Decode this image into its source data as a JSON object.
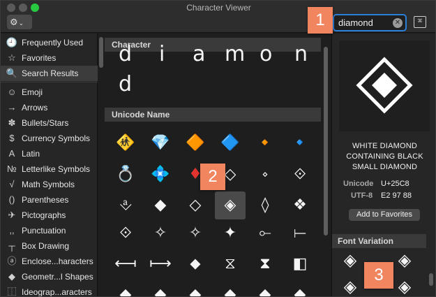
{
  "window": {
    "title": "Character Viewer"
  },
  "toolbar": {
    "gear_icon": "gear-icon",
    "search_value": "diamond",
    "grid_icon": "keyboard-grid-icon"
  },
  "callouts": [
    "1",
    "2",
    "3"
  ],
  "sidebar": {
    "items": [
      {
        "label": "Frequently Used",
        "icon": "🕘"
      },
      {
        "label": "Favorites",
        "icon": "☆"
      },
      {
        "label": "Search Results",
        "icon": "🔍",
        "selected": true
      },
      {
        "label": "Emoji",
        "icon": "☺"
      },
      {
        "label": "Arrows",
        "icon": "→"
      },
      {
        "label": "Bullets/Stars",
        "icon": "✽"
      },
      {
        "label": "Currency Symbols",
        "icon": "$"
      },
      {
        "label": "Latin",
        "icon": "A"
      },
      {
        "label": "Letterlike Symbols",
        "icon": "№"
      },
      {
        "label": "Math Symbols",
        "icon": "√"
      },
      {
        "label": "Parentheses",
        "icon": "()"
      },
      {
        "label": "Pictographs",
        "icon": "✈"
      },
      {
        "label": "Punctuation",
        "icon": ",,"
      },
      {
        "label": "Box Drawing",
        "icon": "┬"
      },
      {
        "label": "Enclose...haracters",
        "icon": "ⓐ"
      },
      {
        "label": "Geometr...l Shapes",
        "icon": "◆"
      },
      {
        "label": "Ideograp...aracters",
        "icon": "⿰"
      }
    ]
  },
  "center": {
    "character_header": "Character",
    "big_chars_row1": [
      "d",
      "i",
      "a",
      "m",
      "o",
      "n"
    ],
    "big_chars_row2": [
      "d"
    ],
    "unicode_header": "Unicode Name",
    "glyph_rows": [
      [
        "🚸",
        "💎",
        "🔶",
        "🔷",
        "🔸",
        "🔹"
      ],
      [
        "💍",
        "💠",
        "♦",
        "◇",
        "⋄",
        "⟐"
      ],
      [
        "⎀",
        "◆",
        "◇",
        "◈",
        "◊",
        "❖"
      ],
      [
        "⟐",
        "✧",
        "✧",
        "✦",
        "⟜",
        "⟝"
      ],
      [
        "⟻",
        "⟼",
        "⬥",
        "⧖",
        "⧗",
        "◧"
      ],
      [
        "◆",
        "◆",
        "◆",
        "◆",
        "◆",
        "◆"
      ]
    ]
  },
  "detail": {
    "name_lines": [
      "WHITE DIAMOND",
      "CONTAINING BLACK",
      "SMALL DIAMOND"
    ],
    "unicode_label": "Unicode",
    "unicode_value": "U+25C8",
    "utf8_label": "UTF-8",
    "utf8_value": "E2 97 88",
    "add_favorites": "Add to Favorites",
    "font_variation_header": "Font Variation",
    "font_variation_glyphs": [
      "◈",
      "◈",
      "◈",
      "◈"
    ]
  }
}
